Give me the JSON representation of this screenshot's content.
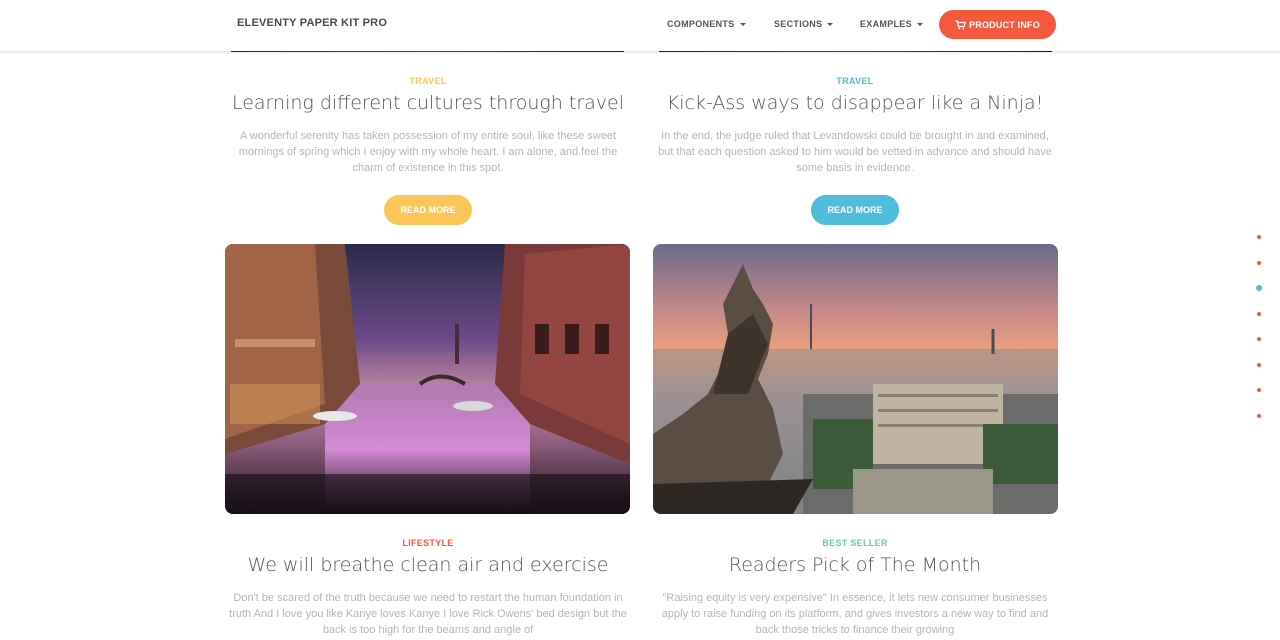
{
  "navbar": {
    "brand": "ELEVENTY PAPER KIT PRO",
    "links": [
      "COMPONENTS",
      "SECTIONS",
      "EXAMPLES"
    ],
    "product_button": "PRODUCT INFO"
  },
  "colors": {
    "accent": "#f5593d",
    "warning": "#fbc658",
    "info": "#51bcda",
    "danger": "#f5593d",
    "success": "#6bd098"
  },
  "cards": [
    {
      "category": "TRAVEL",
      "title": "Learning different cultures through travel",
      "description": "A wonderful serenity has taken possession of my entire soul, like these sweet mornings of spring which I enjoy with my whole heart. I am alone, and feel the charm of existence in this spot.",
      "button": "READ MORE"
    },
    {
      "category": "TRAVEL",
      "title": "Kick-Ass ways to disappear like a Ninja!",
      "description": "In the end, the judge ruled that Levandowski could be brought in and examined, but that each question asked to him would be vetted in advance and should have some basis in evidence.",
      "button": "READ MORE"
    },
    {
      "category": "LIFESTYLE",
      "title": "We will breathe clean air and exercise",
      "description": "Don't be scared of the truth because we need to restart the human foundation in truth And I love you like Kanye loves Kanye I love Rick Owens' bed design but the back is too high for the beams and angle of"
    },
    {
      "category": "BEST SELLER",
      "title": "Readers Pick of The Month",
      "description": "\"Raising equity is very expensive\" In essence, it lets new consumer businesses apply to raise funding on its platform, and gives investors a new way to find and back those tricks to finance their growing"
    }
  ],
  "icons": {
    "cart": "shopping-cart-icon",
    "caret": "caret-down-icon"
  },
  "side_nav": {
    "dot_count": 8,
    "active_index": 2
  }
}
